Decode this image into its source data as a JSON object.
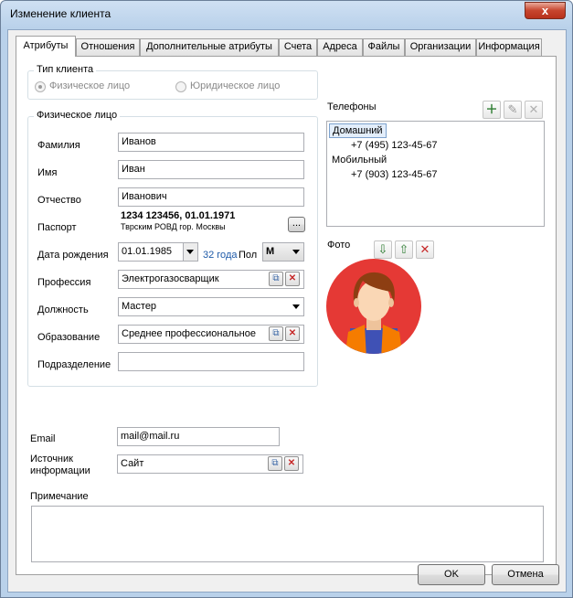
{
  "window": {
    "title": "Изменение клиента",
    "close": "x"
  },
  "tabs": [
    "Атрибуты",
    "Отношения",
    "Дополнительные атрибуты",
    "Счета",
    "Адреса",
    "Файлы",
    "Организации",
    "Информация"
  ],
  "client_type": {
    "title": "Тип клиента",
    "option_individual": "Физическое лицо",
    "option_legal": "Юридическое лицо",
    "selected": "Физическое лицо"
  },
  "person": {
    "title": "Физическое лицо",
    "lastname_label": "Фамилия",
    "lastname_value": "Иванов",
    "firstname_label": "Имя",
    "firstname_value": "Иван",
    "patronymic_label": "Отчество",
    "patronymic_value": "Иванович",
    "passport_label": "Паспорт",
    "passport_number": "1234 123456, 01.01.1971",
    "passport_issued": "Тврским РОВД гор. Москвы",
    "passport_button": "...",
    "birthdate_label": "Дата рождения",
    "birthdate_value": "01.01.1985",
    "age": "32 года",
    "gender_label": "Пол",
    "gender_value": "М",
    "profession_label": "Профессия",
    "profession_value": "Электрогазосварщик",
    "position_label": "Должность",
    "position_value": "Мастер",
    "education_label": "Образование",
    "education_value": "Среднее профессиональное",
    "department_label": "Подразделение",
    "department_value": ""
  },
  "email": {
    "label": "Email",
    "value": "mail@mail.ru"
  },
  "source": {
    "label_line1": "Источник",
    "label_line2": "информации",
    "value": "Сайт"
  },
  "note": {
    "label": "Примечание",
    "value": ""
  },
  "phones": {
    "title": "Телефоны",
    "groups": [
      {
        "name": "Домашний",
        "number": "+7 (495) 123-45-67"
      },
      {
        "name": "Мобильный",
        "number": "+7 (903) 123-45-67"
      }
    ]
  },
  "photo": {
    "title": "Фото"
  },
  "footer": {
    "ok": "OK",
    "cancel": "Отмена"
  },
  "colors": {
    "avatar_bg": "#e53935",
    "hair": "#8d3e12",
    "skin": "#fad7b5",
    "vest": "#f57c00",
    "shirt": "#3f51b5"
  }
}
